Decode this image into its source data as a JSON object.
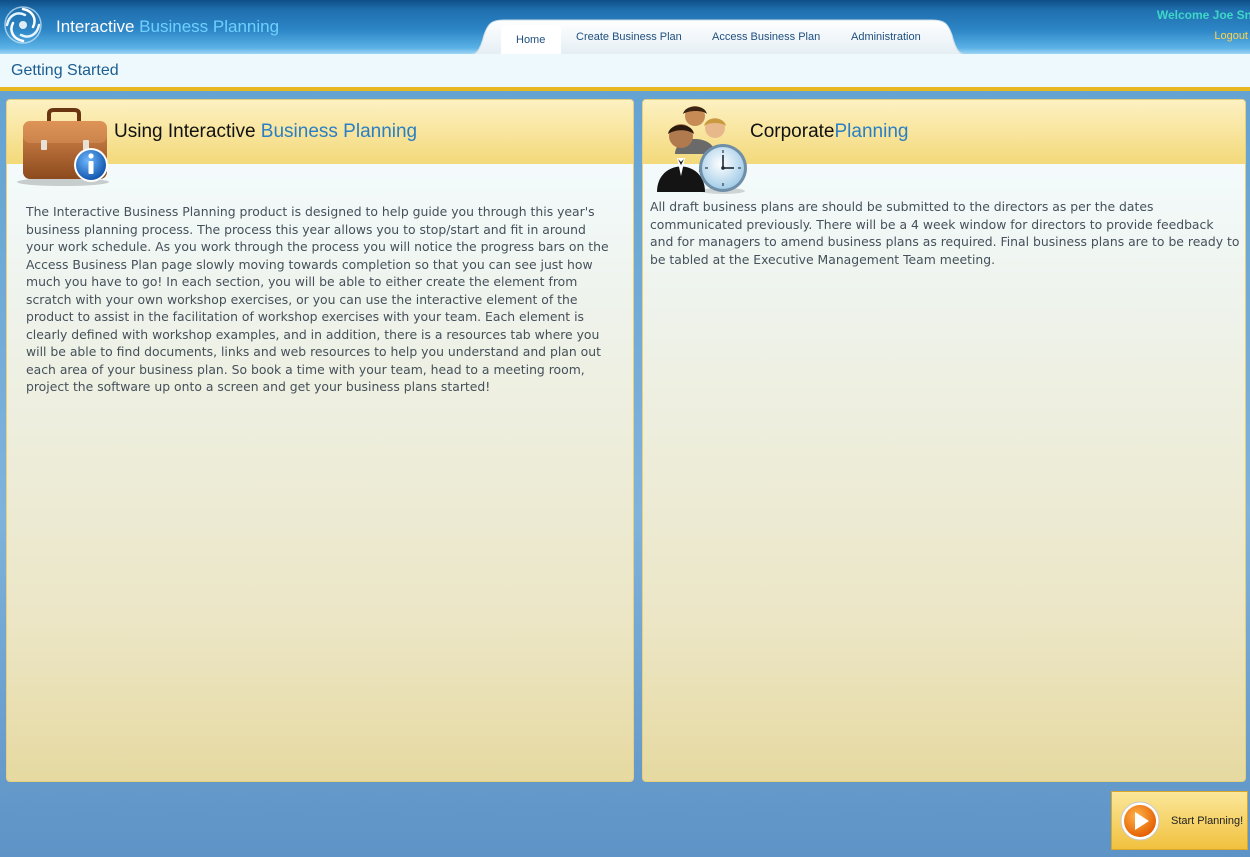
{
  "app": {
    "title_main": "Interactive",
    "title_accent": "Business Planning"
  },
  "nav": {
    "items": [
      {
        "label": "Home"
      },
      {
        "label": "Create Business Plan"
      },
      {
        "label": "Access Business Plan"
      },
      {
        "label": "Administration"
      }
    ]
  },
  "user": {
    "welcome": "Welcome Joe Sn",
    "logout": "Logout"
  },
  "subbar": {
    "title": "Getting Started"
  },
  "panels": [
    {
      "icon": "briefcase-info-icon",
      "title_main": "Using Interactive ",
      "title_accent": "Business Planning",
      "text": "The Interactive Business Planning product is designed to help guide you through this year's business planning process. The process this year allows you to stop/start and fit in around your work schedule. As you work through the process you will notice the progress bars on the Access Business Plan page slowly moving towards completion so that you can see just how much you have to go! In each section, you will be able to either create the element from scratch with your own workshop exercises, or you can use the interactive element of the product to assist in the facilitation of workshop exercises with your team. Each element is clearly defined with workshop examples, and in addition, there is a resources tab where you will be able to find documents, links and web resources to help you understand and plan out each area of your business plan. So book a time with your team, head to a meeting room, project the software up onto a screen and get your business plans started!"
    },
    {
      "icon": "people-clock-icon",
      "title_main": "Corporate",
      "title_accent": "Planning",
      "text": "All draft business plans are should be submitted to the directors as per the dates communicated previously. There will be a 4 week window for directors to provide feedback and for managers to amend business plans as required. Final business plans are to be ready to be tabled at the Executive Management Team meeting."
    }
  ],
  "start_button": {
    "label": "Start Planning!",
    "icon": "play-icon"
  },
  "colors": {
    "accent_blue": "#2a7fc4",
    "gold": "#e9b71f",
    "nav_text": "#1f4f7f",
    "welcome": "#3fd6c8",
    "logout": "#ffd24a"
  }
}
